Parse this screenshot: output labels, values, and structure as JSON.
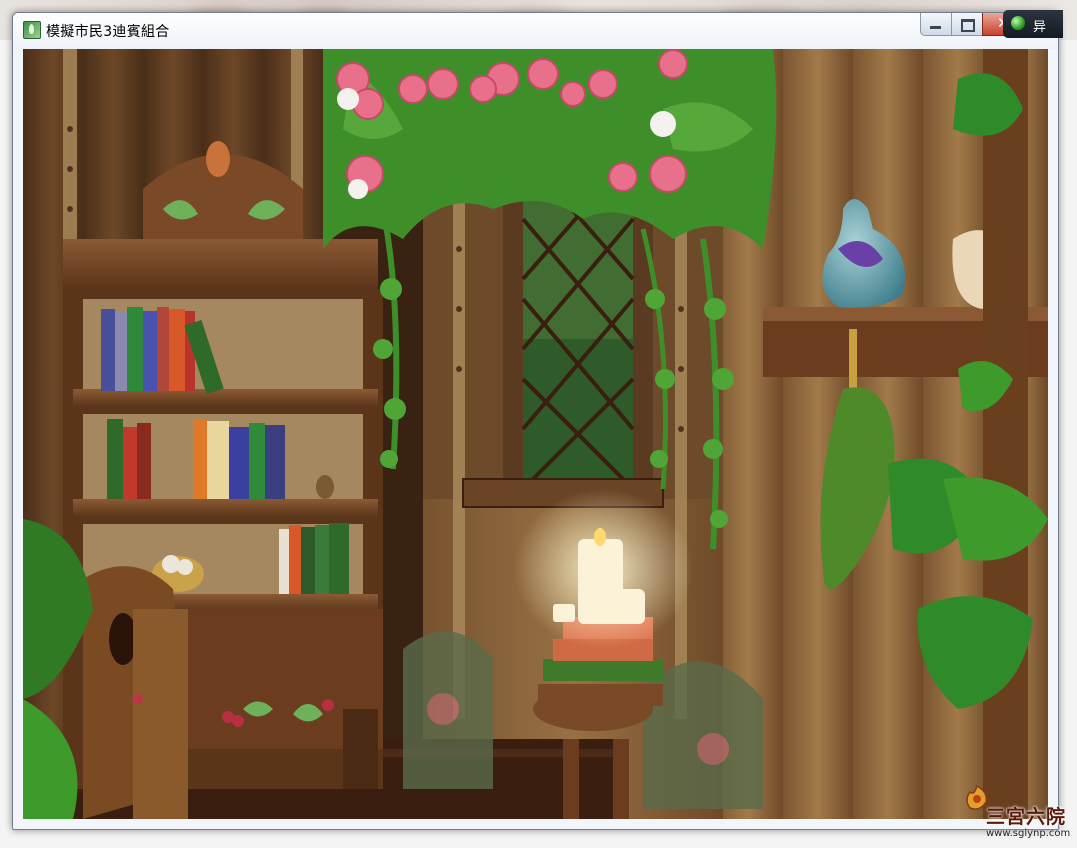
{
  "window": {
    "title": "模擬市民3迪賓組合",
    "controls": {
      "minimize_icon": "minimize-icon",
      "maximize_icon": "maximize-icon",
      "close_icon": "close-icon",
      "close_glyph": "✕"
    }
  },
  "tray_chip": {
    "icon": "gem-icon",
    "label": "异"
  },
  "scene": {
    "description_icon": "game-scene",
    "colors": {
      "wood_dark": "#3b2414",
      "wood_mid": "#6b4426",
      "wood_light": "#8a5a34",
      "leaf": "#3e8f2a",
      "rose": "#e8708a"
    }
  },
  "watermark": {
    "title": "三宮六院",
    "url": "www.sglynp.com"
  }
}
